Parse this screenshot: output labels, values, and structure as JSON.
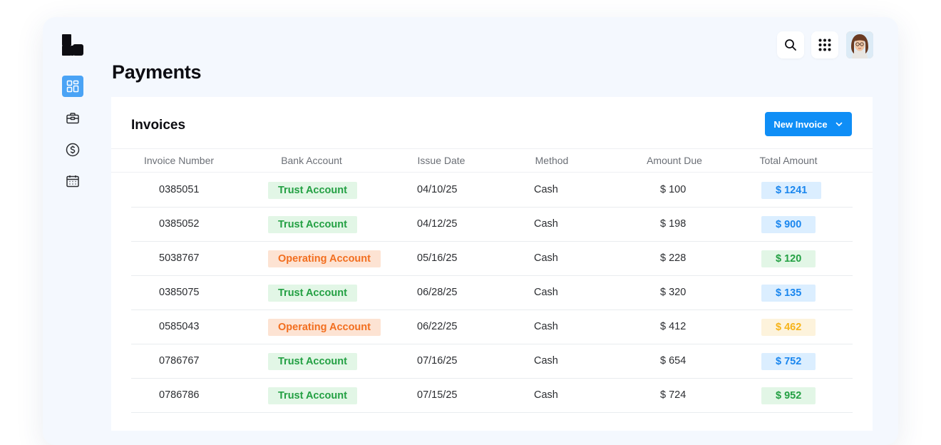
{
  "page": {
    "title": "Payments"
  },
  "card": {
    "title": "Invoices",
    "new_button_label": "New Invoice"
  },
  "sidebar": {
    "items": [
      {
        "icon": "dashboard-icon",
        "active": true
      },
      {
        "icon": "briefcase-icon",
        "active": false
      },
      {
        "icon": "dollar-icon",
        "active": false
      },
      {
        "icon": "calendar-icon",
        "active": false
      }
    ]
  },
  "topbar": {
    "search_icon": "search-icon",
    "apps_icon": "apps-grid-icon",
    "avatar": "user-avatar"
  },
  "colors": {
    "primary": "#0f8ef6",
    "trust_account": "#23a043",
    "operating_account": "#f26e1f",
    "total_blue": "#1a86ee",
    "total_green": "#23a043",
    "total_yellow": "#f6b41a"
  },
  "table": {
    "columns": [
      "Invoice Number",
      "Bank Account",
      "Issue Date",
      "Method",
      "Amount Due",
      "Total Amount"
    ],
    "rows": [
      {
        "invoice_number": "0385051",
        "bank_account": "Trust Account",
        "bank_type": "green",
        "issue_date": "04/10/25",
        "method": "Cash",
        "amount_due": "$ 100",
        "total_amount": "$ 1241",
        "total_color": "blue"
      },
      {
        "invoice_number": "0385052",
        "bank_account": "Trust Account",
        "bank_type": "green",
        "issue_date": "04/12/25",
        "method": "Cash",
        "amount_due": "$ 198",
        "total_amount": "$ 900",
        "total_color": "blue"
      },
      {
        "invoice_number": "5038767",
        "bank_account": "Operating Account",
        "bank_type": "orange",
        "issue_date": "05/16/25",
        "method": "Cash",
        "amount_due": "$ 228",
        "total_amount": "$ 120",
        "total_color": "green"
      },
      {
        "invoice_number": "0385075",
        "bank_account": "Trust Account",
        "bank_type": "green",
        "issue_date": "06/28/25",
        "method": "Cash",
        "amount_due": "$ 320",
        "total_amount": "$ 135",
        "total_color": "blue"
      },
      {
        "invoice_number": "0585043",
        "bank_account": "Operating Account",
        "bank_type": "orange",
        "issue_date": "06/22/25",
        "method": "Cash",
        "amount_due": "$ 412",
        "total_amount": "$ 462",
        "total_color": "yellow"
      },
      {
        "invoice_number": "0786767",
        "bank_account": "Trust Account",
        "bank_type": "green",
        "issue_date": "07/16/25",
        "method": "Cash",
        "amount_due": "$ 654",
        "total_amount": "$ 752",
        "total_color": "blue"
      },
      {
        "invoice_number": "0786786",
        "bank_account": "Trust Account",
        "bank_type": "green",
        "issue_date": "07/15/25",
        "method": "Cash",
        "amount_due": "$ 724",
        "total_amount": "$ 952",
        "total_color": "green"
      }
    ]
  }
}
